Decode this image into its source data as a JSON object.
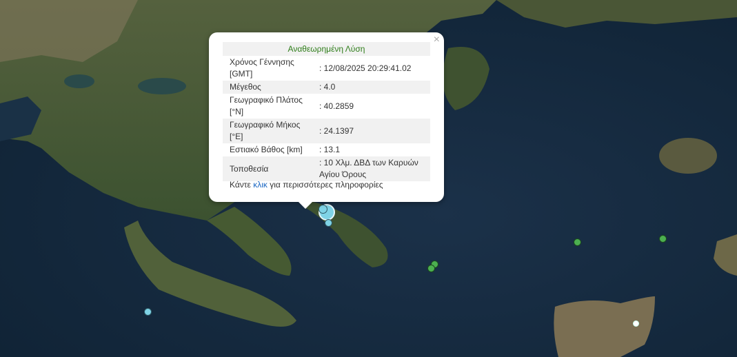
{
  "popup": {
    "title": "Αναθεωρημένη Λύση",
    "close_symbol": "×",
    "rows": [
      {
        "label": "Χρόνος Γέννησης [GMT]",
        "value": ": 12/08/2025 20:29:41.02"
      },
      {
        "label": "Μέγεθος",
        "value": ": 4.0"
      },
      {
        "label": "Γεωγραφικό Πλάτος [°N]",
        "value": ": 40.2859"
      },
      {
        "label": "Γεωγραφικό Μήκος [°E]",
        "value": ": 24.1397"
      },
      {
        "label": "Εστιακό Βάθος [km]",
        "value": ": 13.1"
      },
      {
        "label": "Τοποθεσία",
        "value": ": 10 Χλμ. ΔΒΔ των Καρυών Αγίου Όρους"
      }
    ],
    "more_prefix": "Κάντε",
    "more_link": "κλικ",
    "more_suffix": "για περισσότερες πληροφορίες"
  },
  "colors": {
    "sea": "#13283d",
    "land_dark": "#2f4a2a",
    "land_light": "#6b7050",
    "recent_marker": "#7fd3e6",
    "older_marker": "#4caf50",
    "title_green": "#2e7d19",
    "link_blue": "#1a66c2"
  },
  "markers": [
    {
      "type": "recent",
      "label": "selected-event"
    },
    {
      "type": "recent",
      "label": "event"
    },
    {
      "type": "recent",
      "label": "event"
    },
    {
      "type": "recent",
      "label": "event"
    },
    {
      "type": "older",
      "label": "event"
    },
    {
      "type": "older",
      "label": "event"
    },
    {
      "type": "older",
      "label": "event"
    },
    {
      "type": "older",
      "label": "event"
    }
  ]
}
